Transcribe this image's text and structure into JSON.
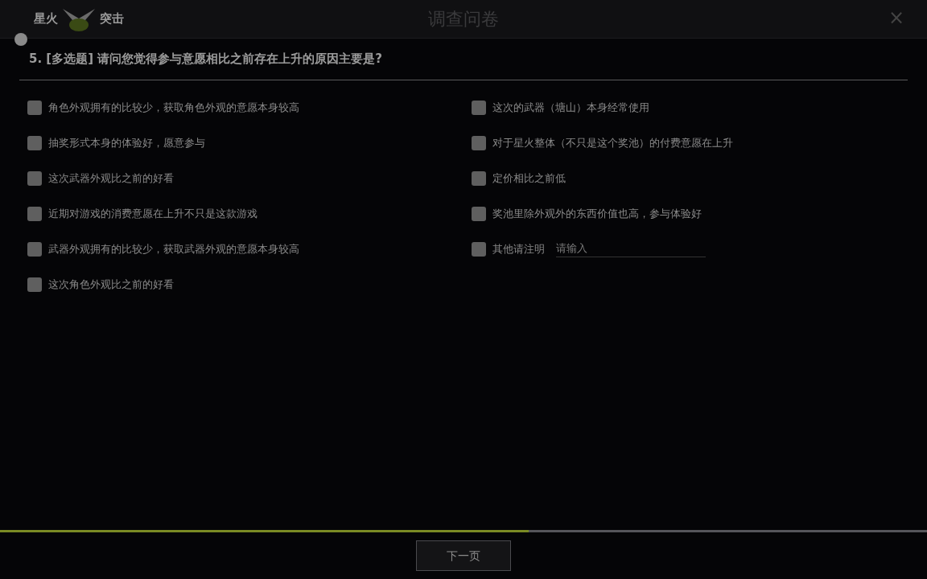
{
  "window": {
    "logo_left": "星火",
    "logo_right": "突击",
    "title": "调查问卷",
    "close": "×"
  },
  "question": {
    "number": "5.",
    "type": "[多选题]",
    "text": "请问您觉得参与意愿相比之前存在上升的原因主要是?"
  },
  "options": [
    {
      "label": "角色外观拥有的比较少，获取角色外观的意愿本身较高",
      "checked": false,
      "kind": "plain"
    },
    {
      "label": "这次的武器（塘山）本身经常使用",
      "checked": false,
      "kind": "plain"
    },
    {
      "label": "抽奖形式本身的体验好，愿意参与",
      "checked": false,
      "kind": "plain"
    },
    {
      "label": "对于星火整体（不只是这个奖池）的付费意愿在上升",
      "checked": false,
      "kind": "plain"
    },
    {
      "label": "这次武器外观比之前的好看",
      "checked": false,
      "kind": "plain"
    },
    {
      "label": "定价相比之前低",
      "checked": false,
      "kind": "plain"
    },
    {
      "label": "近期对游戏的消费意愿在上升不只是这款游戏",
      "checked": false,
      "kind": "plain"
    },
    {
      "label": "奖池里除外观外的东西价值也高，参与体验好",
      "checked": false,
      "kind": "plain"
    },
    {
      "label": "武器外观拥有的比较少，获取武器外观的意愿本身较高",
      "checked": false,
      "kind": "plain"
    },
    {
      "label": "其他请注明",
      "checked": false,
      "kind": "other",
      "placeholder": "请输入"
    },
    {
      "label": "这次角色外观比之前的好看",
      "checked": false,
      "kind": "plain"
    }
  ],
  "progress": {
    "level": 0.57
  },
  "next_button": "下一页"
}
